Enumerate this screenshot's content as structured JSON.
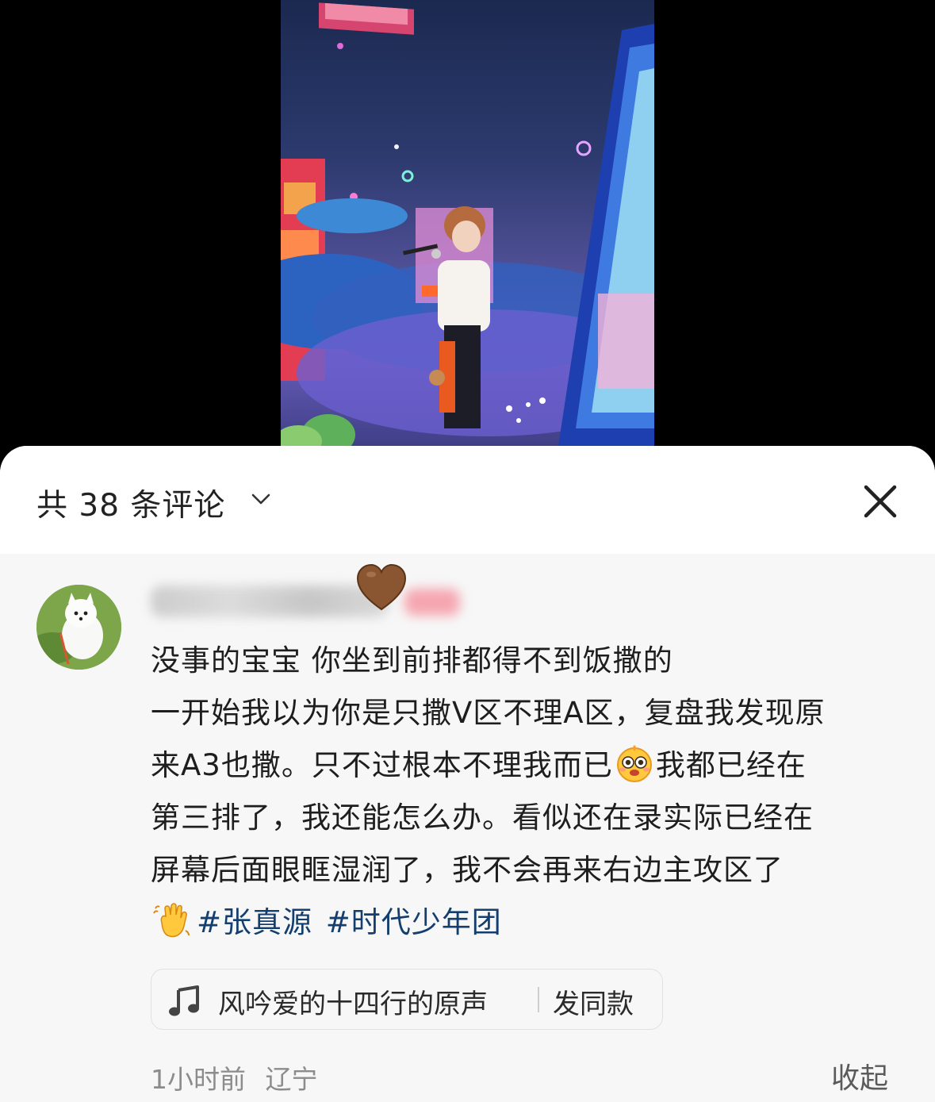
{
  "header": {
    "comment_count": "共 38 条评论",
    "chevron_icon": "chevron-down-icon",
    "close_icon": "close-icon"
  },
  "comment": {
    "avatar_icon": "dog-avatar",
    "heart_emoji": "brown-heart-emoji",
    "lines": [
      "没事的宝宝 你坐到前排都得不到饭撒的",
      "一开始我以为你是只撒V区不理A区，复盘我发现原",
      "来A3也撒。只不过根本不理我而已",
      "我都已经在",
      "第三排了，我还能怎么办。看似还在录实际已经在",
      "屏幕后面眼眶湿润了，我不会再来右边主攻区了"
    ],
    "emoji_1": "crying-face-emoji",
    "emoji_2": "waving-hand-emoji",
    "hashtags": [
      "#张真源",
      "#时代少年团"
    ],
    "music": {
      "icon": "music-note-icon",
      "title": "风吟爱的十四行的原声",
      "action": "发同款"
    },
    "time": "1小时前",
    "location": "辽宁",
    "collapse_label": "收起"
  },
  "colors": {
    "hashtag": "#133e6e",
    "meta": "#8c8c8c",
    "sheet_bg": "#f7f7f7"
  }
}
